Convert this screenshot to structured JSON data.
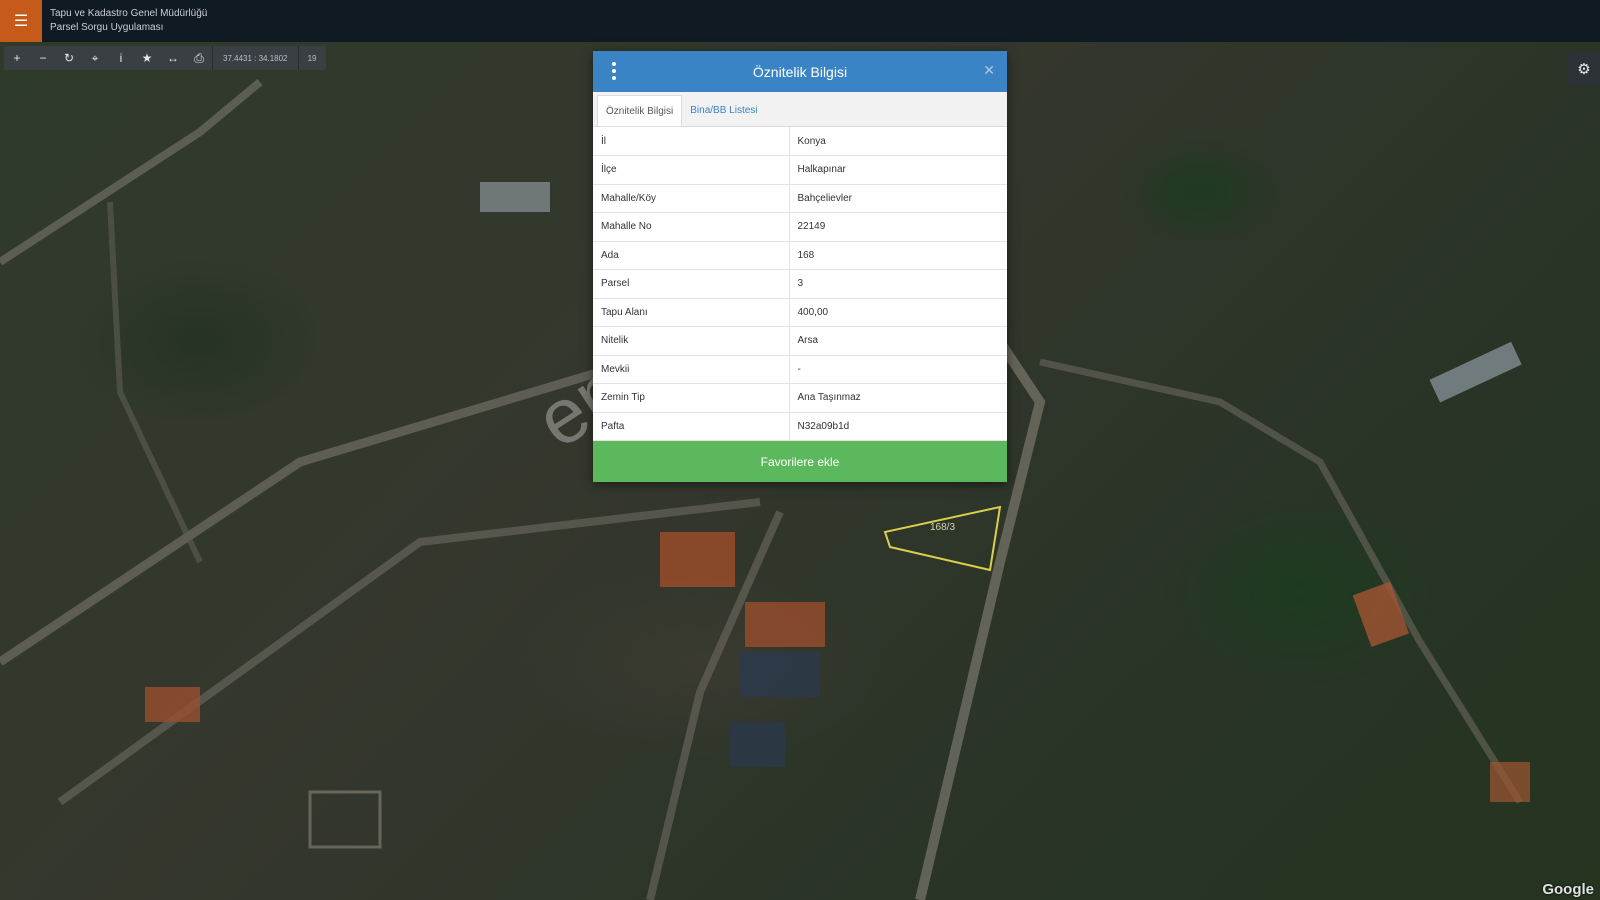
{
  "header": {
    "org_name": "Tapu ve Kadastro Genel Müdürlüğü",
    "app_name": "Parsel Sorgu Uygulaması"
  },
  "toolbar": {
    "coordinates": "37.4431 : 34.1802",
    "zoom_level": "19",
    "tools": [
      "zoom-in-icon",
      "zoom-out-icon",
      "refresh-icon",
      "locate-icon",
      "info-icon",
      "star-icon",
      "measure-icon",
      "print-icon"
    ]
  },
  "modal": {
    "title": "Öznitelik Bilgisi",
    "tabs": [
      {
        "label": "Öznitelik Bilgisi",
        "active": true
      },
      {
        "label": "Bina/BB Listesi",
        "active": false
      }
    ],
    "rows": [
      {
        "key": "İl",
        "value": "Konya"
      },
      {
        "key": "İlçe",
        "value": "Halkapınar"
      },
      {
        "key": "Mahalle/Köy",
        "value": "Bahçelievler"
      },
      {
        "key": "Mahalle No",
        "value": "22149"
      },
      {
        "key": "Ada",
        "value": "168"
      },
      {
        "key": "Parsel",
        "value": "3"
      },
      {
        "key": "Tapu Alanı",
        "value": "400,00"
      },
      {
        "key": "Nitelik",
        "value": "Arsa"
      },
      {
        "key": "Mevkii",
        "value": "-"
      },
      {
        "key": "Zemin Tip",
        "value": "Ana Taşınmaz"
      },
      {
        "key": "Pafta",
        "value": "N32a09b1d"
      }
    ],
    "favorite_button": "Favorilere ekle"
  },
  "map": {
    "parcel_label": "168/3",
    "watermark": "emlakjet.com",
    "attribution": "Google"
  },
  "colors": {
    "header_bg": "#0f1a22",
    "menu_accent": "#c65a1a",
    "modal_header": "#3a84c6",
    "favorite_button": "#5cb85c",
    "parcel_outline": "#d9cf4a"
  }
}
